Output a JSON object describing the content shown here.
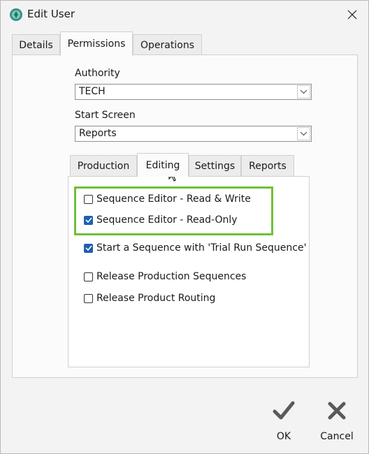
{
  "window": {
    "title": "Edit User"
  },
  "outer_tabs": [
    {
      "label": "Details"
    },
    {
      "label": "Permissions"
    },
    {
      "label": "Operations"
    }
  ],
  "authority": {
    "label": "Authority",
    "value": "TECH"
  },
  "start_screen": {
    "label": "Start Screen",
    "value": "Reports"
  },
  "inner_tabs": [
    {
      "label": "Production"
    },
    {
      "label": "Editing"
    },
    {
      "label": "Settings"
    },
    {
      "label": "Reports"
    }
  ],
  "permissions": [
    {
      "label": "Sequence Editor - Read & Write",
      "checked": false
    },
    {
      "label": "Sequence Editor - Read-Only",
      "checked": true
    },
    {
      "label": "Start a Sequence with 'Trial Run Sequence'",
      "checked": true
    },
    {
      "label": "Release Production Sequences",
      "checked": false
    },
    {
      "label": "Release Product Routing",
      "checked": false
    }
  ],
  "actions": {
    "ok_label": "OK",
    "cancel_label": "Cancel"
  },
  "colors": {
    "accent": "#1f5fb4",
    "highlight": "#6fbf3a"
  }
}
